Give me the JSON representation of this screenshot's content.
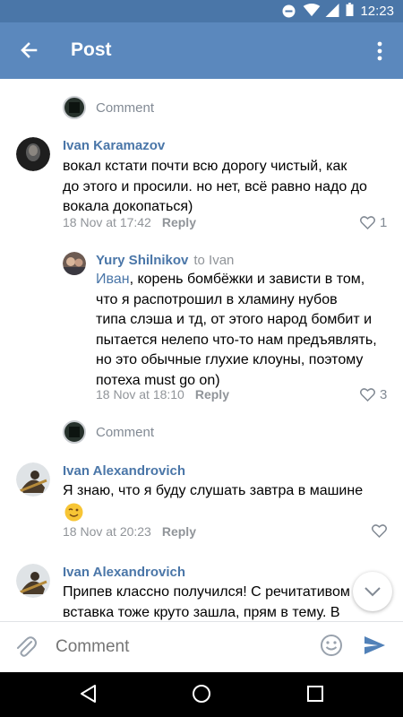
{
  "status_bar": {
    "time": "12:23",
    "icons": [
      "do-not-disturb-icon",
      "wifi-icon",
      "signal-icon",
      "battery-icon"
    ]
  },
  "app_bar": {
    "title": "Post",
    "icons": [
      "back-arrow-icon",
      "more-vertical-icon"
    ]
  },
  "thread": {
    "comment_links": [
      {
        "label": "Comment"
      },
      {
        "label": "Comment"
      }
    ],
    "comments": [
      {
        "author": "Ivan Karamazov",
        "text_lines": [
          "вокал кстати почти всю дорогу чистый, как",
          "до этого и просили. но нет, всё равно надо до",
          "вокала докопаться)"
        ],
        "date": "18 Nov at 17:42",
        "reply_label": "Reply",
        "likes": "1"
      },
      {
        "author": "Yury Shilnikov",
        "reply_to": "to Ivan",
        "mention": "Иван",
        "text_lines": [
          ", корень бомбёжки и зависти в том,",
          "что я распотрошил в хламину нубов",
          "типа слэша и тд, от этого народ бомбит и",
          "пытается нелепо что-то нам предъявлять,",
          "но это обычные глухие клоуны, поэтому",
          "потеха must go on)"
        ],
        "date": "18 Nov at 18:10",
        "reply_label": "Reply",
        "likes": "3"
      },
      {
        "author": "Ivan Alexandrovich",
        "text_lines": [
          "Я знаю, что я буду слушать завтра в машине"
        ],
        "emoji": "winking-face-emoji",
        "date": "18 Nov at 20:23",
        "reply_label": "Reply",
        "likes": ""
      },
      {
        "author": "Ivan Alexandrovich",
        "text_lines": [
          "Припев классно получился! С речитативом",
          "вставка тоже круто зашла, прям в тему. В"
        ]
      }
    ]
  },
  "composer": {
    "placeholder": "Comment",
    "icons": [
      "attach-icon",
      "emoji-icon",
      "send-icon"
    ]
  },
  "nav_bar": {
    "icons": [
      "nav-back-icon",
      "nav-home-icon",
      "nav-recents-icon"
    ]
  },
  "colors": {
    "status_bar": "#4a76a8",
    "app_bar": "#5b88bd",
    "link": "#4a76a8",
    "secondary_text": "#909499"
  }
}
